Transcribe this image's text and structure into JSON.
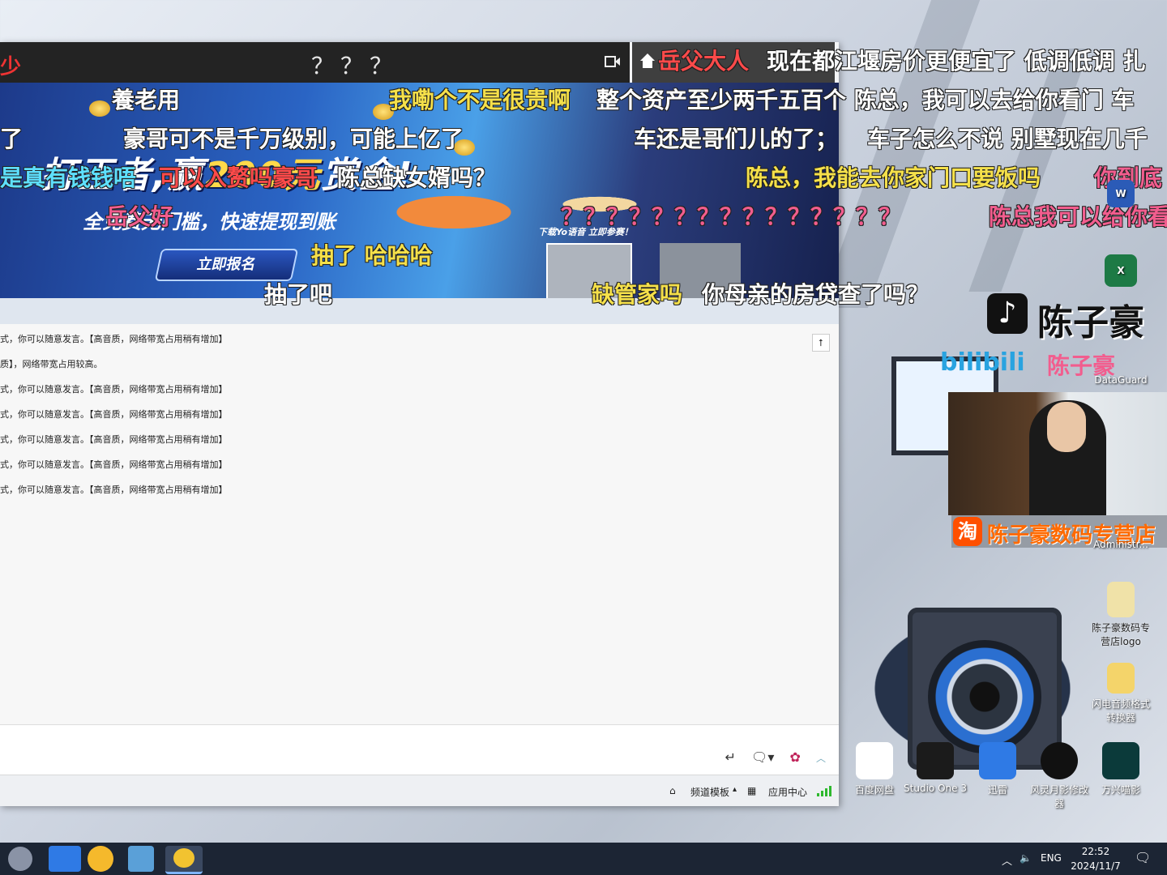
{
  "window": {
    "left_mark": "少",
    "title": "？？？"
  },
  "banner": {
    "headline_left": "打王者,赢",
    "headline_amount": "200元",
    "headline_right": "赏金!",
    "subtitle": "全免费无门槛，快速提现到账",
    "cta": "立即报名",
    "promo": "下载Yo语音 立即参赛！"
  },
  "chat": {
    "lines": [
      "式，你可以随意发言。【高音质，网络带宽占用稍有增加】",
      "质】，网络带宽占用较高。",
      "式，你可以随意发言。【高音质，网络带宽占用稍有增加】",
      "式，你可以随意发言。【高音质，网络带宽占用稍有增加】",
      "式，你可以随意发言。【高音质，网络带宽占用稍有增加】",
      "式，你可以随意发言。【高音质，网络带宽占用稍有增加】",
      "式，你可以随意发言。【高音质，网络带宽占用稍有增加】"
    ]
  },
  "bottombar": {
    "channel_template": "频道模板",
    "app_center": "应用中心"
  },
  "danmaku": [
    {
      "text": "岳父大人",
      "color": "#ff4a4a"
    },
    {
      "text": "现在都江堰房价更便宜了 低调低调 扎",
      "color": "#ffffff"
    },
    {
      "text": "養老用",
      "color": "#ffffff"
    },
    {
      "text": "我嘞个不是很贵啊",
      "color": "#f5e04a"
    },
    {
      "text": "整个资产至少两千五百个 陈总，我可以去给你看门 车",
      "color": "#ffffff"
    },
    {
      "text": "了",
      "color": "#ffffff"
    },
    {
      "text": "豪哥可不是千万级别，可能上亿了",
      "color": "#ffffff"
    },
    {
      "text": "车还是哥们儿的了；",
      "color": "#ffffff"
    },
    {
      "text": "车子怎么不说 别墅现在几千",
      "color": "#ffffff"
    },
    {
      "text": "是真有钱钱唔",
      "color": "#5ee0ff"
    },
    {
      "text": "可以入赘吗豪哥",
      "color": "#ff4a4a"
    },
    {
      "text": "陈总缺女婿吗？",
      "color": "#ffffff"
    },
    {
      "text": "陈总，我能去你家门口要饭吗",
      "color": "#f5e04a"
    },
    {
      "text": "你到底",
      "color": "#f25d8e"
    },
    {
      "text": "岳父好",
      "color": "#f25d8e"
    },
    {
      "text": "？？？？？？？？？？？？？？？",
      "color": "#f25d8e"
    },
    {
      "text": "陈总我可以给你看",
      "color": "#f25d8e"
    },
    {
      "text": "抽了 哈哈哈",
      "color": "#f5e04a"
    },
    {
      "text": "抽了吧",
      "color": "#ffffff"
    },
    {
      "text": "缺管家吗",
      "color": "#f5e04a"
    },
    {
      "text": "你母亲的房贷查了吗？",
      "color": "#ffffff"
    }
  ],
  "stream": {
    "tiktok_name": "陈子豪",
    "bili_logo": "bilibili",
    "bili_name": "陈子豪",
    "shop": "陈子豪数码专营店"
  },
  "desktop": {
    "icons_right": [
      {
        "label": "DataGuard"
      },
      {
        "label": "Administr..."
      },
      {
        "label": "陈子豪数码专营店logo"
      },
      {
        "label": "闪电音频格式转换器"
      }
    ],
    "icons_bottom": [
      {
        "label": "百度网盘"
      },
      {
        "label": "Studio One 3"
      },
      {
        "label": "迅雷"
      },
      {
        "label": "风灵月影修改器"
      },
      {
        "label": "万兴喵影"
      }
    ]
  },
  "taskbar": {
    "lang": "ENG",
    "time": "22:52",
    "date": "2024/11/7"
  },
  "icons": [
    "home-icon",
    "camera-icon",
    "scroll-top-icon",
    "enter-icon",
    "chat-bubble-icon",
    "rose-icon",
    "chevron-up-icon",
    "channel-template-icon",
    "app-grid-icon",
    "signal-icon",
    "speaker-icon",
    "notification-icon"
  ]
}
